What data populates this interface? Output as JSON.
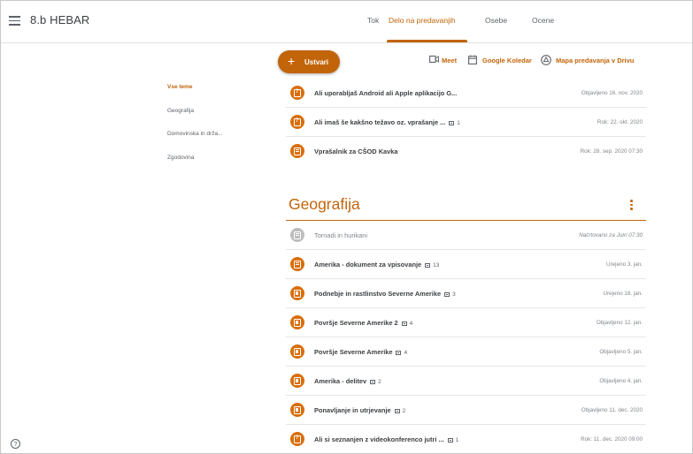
{
  "header": {
    "class_name": "8.b HEBAR",
    "tabs": [
      {
        "label": "Tok"
      },
      {
        "label": "Delo na predavanjih"
      },
      {
        "label": "Osebe"
      },
      {
        "label": "Ocene"
      }
    ],
    "active_tab": "Delo na predavanjih"
  },
  "sidebar": {
    "items": [
      {
        "label": "Vse teme"
      },
      {
        "label": "Geografija"
      },
      {
        "label": "Domovinska in drža..."
      },
      {
        "label": "Zgodovina"
      }
    ],
    "active_item": "Vse teme"
  },
  "toolbar": {
    "create_label": "Ustvari",
    "meet_label": "Meet",
    "calendar_label": "Google Koledar",
    "drive_label": "Mapa predavanja v Drivu"
  },
  "unassigned": [
    {
      "icon": "question-icon",
      "title": "Ali uporabljaš Android ali Apple aplikacijo G...",
      "comments": "",
      "date": "Objavljeno 16. nov. 2020"
    },
    {
      "icon": "question-icon",
      "title": "Ali imaš še kakšno težavo oz. vprašanje ...",
      "comments": "1",
      "date": "Rok: 22. okt. 2020"
    },
    {
      "icon": "assignment-icon",
      "title": "Vprašalnik za CŠOD Kavka",
      "comments": "",
      "date": "Rok: 28. sep. 2020 07:30"
    }
  ],
  "topic": {
    "title": "Geografija",
    "items": [
      {
        "icon": "assignment-icon",
        "title": "Tornadi in hurikani",
        "comments": "",
        "date": "Načrtovano za Jutri 07:30",
        "scheduled": true
      },
      {
        "icon": "assignment-icon",
        "title": "Amerika - dokument za vpisovanje",
        "comments": "13",
        "date": "Urejeno 3. jan."
      },
      {
        "icon": "material-icon",
        "title": "Podnebje in rastlinstvo Severne Amerike",
        "comments": "3",
        "date": "Urejeno 18. jan."
      },
      {
        "icon": "material-icon",
        "title": "Površje Severne Amerike 2",
        "comments": "4",
        "date": "Objavljeno 12. jan."
      },
      {
        "icon": "material-icon",
        "title": "Površje Severne Amerike",
        "comments": "4",
        "date": "Objavljeno 5. jan."
      },
      {
        "icon": "material-icon",
        "title": "Amerika - delitev",
        "comments": "2",
        "date": "Objavljeno 4. jan."
      },
      {
        "icon": "material-icon",
        "title": "Ponavljanje in utrjevanje",
        "comments": "2",
        "date": "Objavljeno 11. dec. 2020"
      },
      {
        "icon": "question-icon",
        "title": "Ali si seznanjen z videokonferenco jutri ...",
        "comments": "1",
        "date": "Rok: 11. dec. 2020 09:00"
      }
    ]
  },
  "footer": {
    "help_icon": "help-icon"
  },
  "colors": {
    "accent": "#c2650a",
    "icon_bg": "#d96e0b",
    "scheduled_icon_bg": "#bdbdbd"
  }
}
